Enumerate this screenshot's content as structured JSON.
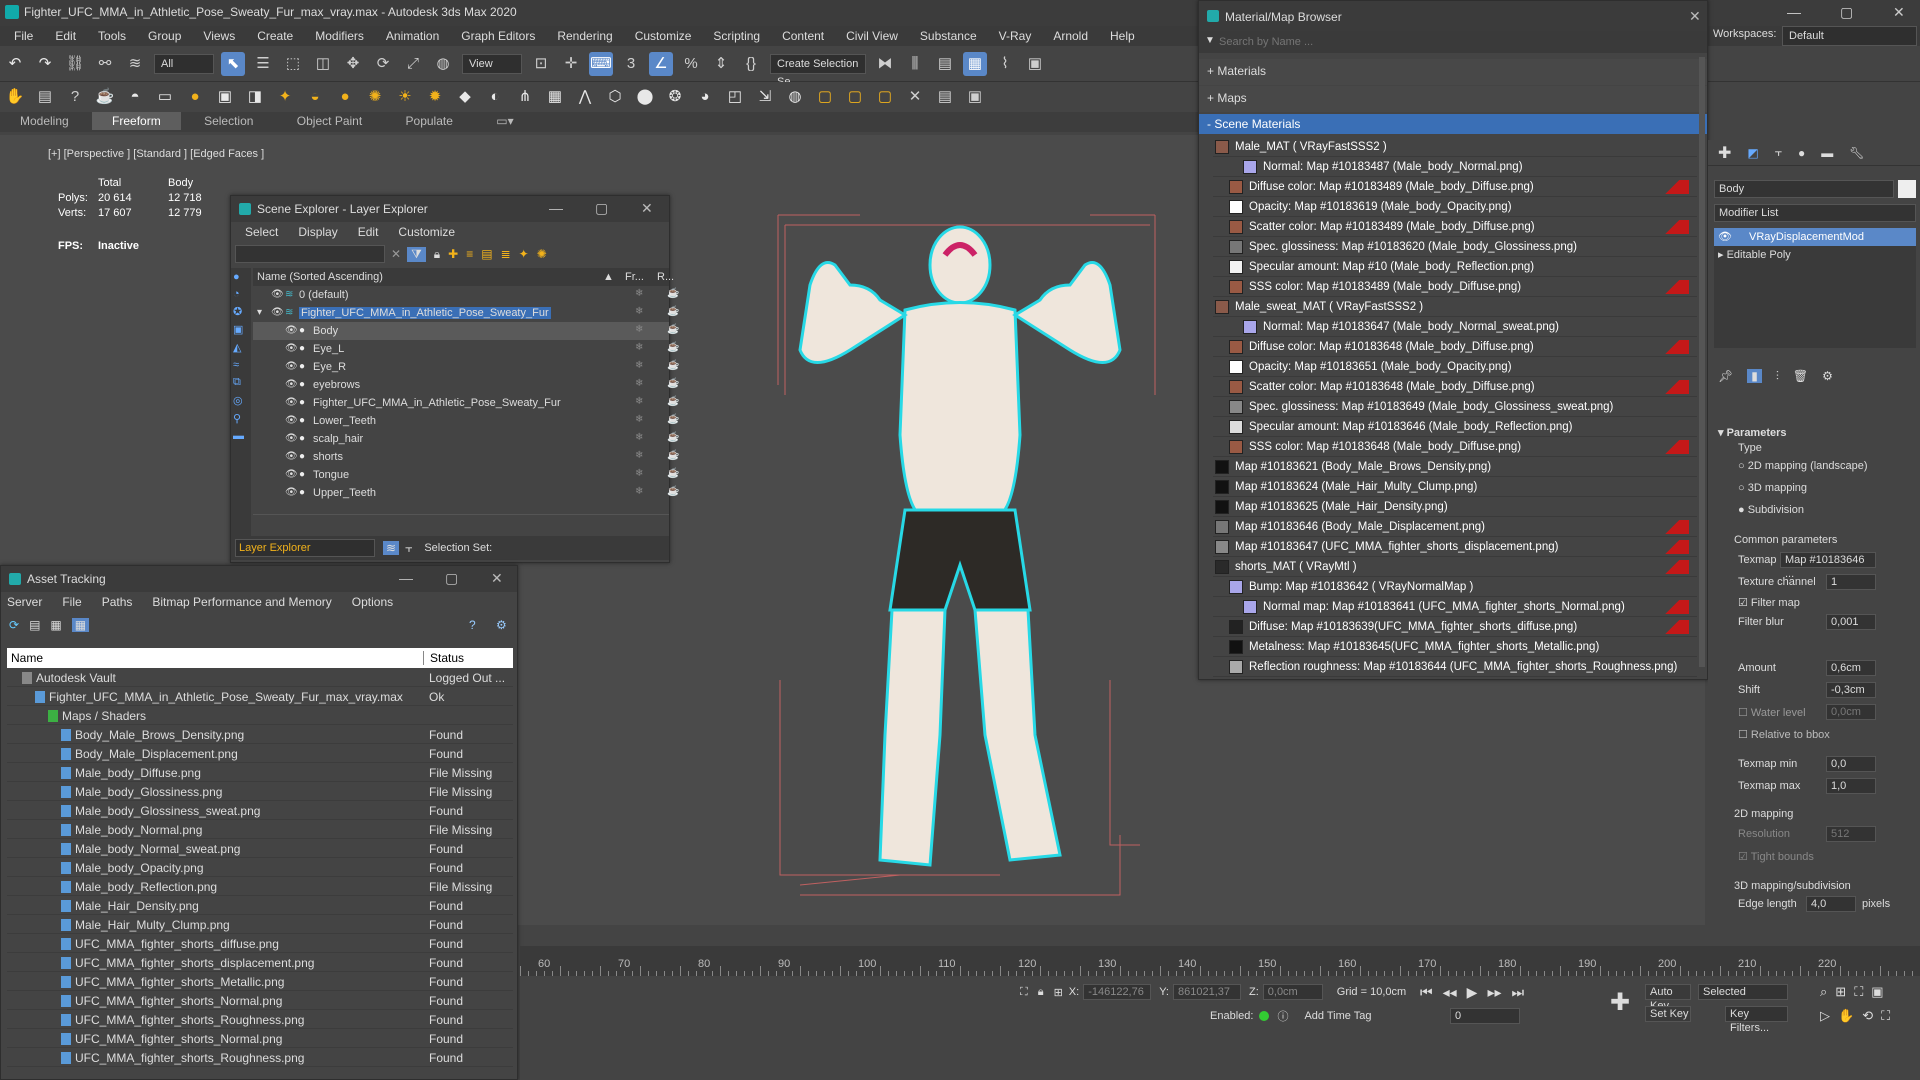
{
  "window": {
    "title": "Fighter_UFC_MMA_in_Athletic_Pose_Sweaty_Fur_max_vray.max - Autodesk 3ds Max 2020",
    "workspaces_label": "Workspaces:",
    "workspace": "Default"
  },
  "menu": [
    "File",
    "Edit",
    "Tools",
    "Group",
    "Views",
    "Create",
    "Modifiers",
    "Animation",
    "Graph Editors",
    "Rendering",
    "Customize",
    "Scripting",
    "Content",
    "Civil View",
    "Substance",
    "V-Ray",
    "Arnold",
    "Help"
  ],
  "toolbar": {
    "selection_filter": "All",
    "ref_coord": "View",
    "create_selection_set": "Create Selection Se"
  },
  "ribbon_tabs": [
    "Modeling",
    "Freeform",
    "Selection",
    "Object Paint",
    "Populate"
  ],
  "viewport": {
    "label": "[+] [Perspective ] [Standard ] [Edged Faces ]",
    "stats": {
      "col_total": "Total",
      "col_body": "Body",
      "polys_label": "Polys:",
      "polys_total": "20 614",
      "polys_body": "12 718",
      "verts_label": "Verts:",
      "verts_total": "17 607",
      "verts_body": "12 779",
      "fps_label": "FPS:",
      "fps_value": "Inactive"
    }
  },
  "scene_explorer": {
    "title": "Scene Explorer - Layer Explorer",
    "menu": [
      "Select",
      "Display",
      "Edit",
      "Customize"
    ],
    "col_name": "Name (Sorted Ascending)",
    "col_fr": "Fr...",
    "col_r": "R...",
    "rows": [
      {
        "name": "0 (default)",
        "indent": 0
      },
      {
        "name": "Fighter_UFC_MMA_in_Athletic_Pose_Sweaty_Fur",
        "indent": 0
      },
      {
        "name": "Body",
        "indent": 1
      },
      {
        "name": "Eye_L",
        "indent": 1
      },
      {
        "name": "Eye_R",
        "indent": 1
      },
      {
        "name": "eyebrows",
        "indent": 1
      },
      {
        "name": "Fighter_UFC_MMA_in_Athletic_Pose_Sweaty_Fur",
        "indent": 1
      },
      {
        "name": "Lower_Teeth",
        "indent": 1
      },
      {
        "name": "scalp_hair",
        "indent": 1
      },
      {
        "name": "shorts",
        "indent": 1
      },
      {
        "name": "Tongue",
        "indent": 1
      },
      {
        "name": "Upper_Teeth",
        "indent": 1
      }
    ],
    "footer_mode": "Layer Explorer",
    "selection_set_label": "Selection Set:"
  },
  "asset_tracking": {
    "title": "Asset Tracking",
    "menu": [
      "Server",
      "File",
      "Paths",
      "Bitmap Performance and Memory",
      "Options"
    ],
    "col_name": "Name",
    "col_status": "Status",
    "rows": [
      {
        "name": "Autodesk Vault",
        "status": "Logged Out ...",
        "indent": 1
      },
      {
        "name": "Fighter_UFC_MMA_in_Athletic_Pose_Sweaty_Fur_max_vray.max",
        "status": "Ok",
        "indent": 2
      },
      {
        "name": "Maps / Shaders",
        "status": "",
        "indent": 3
      },
      {
        "name": "Body_Male_Brows_Density.png",
        "status": "Found",
        "indent": 4
      },
      {
        "name": "Body_Male_Displacement.png",
        "status": "Found",
        "indent": 4
      },
      {
        "name": "Male_body_Diffuse.png",
        "status": "File Missing",
        "indent": 4
      },
      {
        "name": "Male_body_Glossiness.png",
        "status": "File Missing",
        "indent": 4
      },
      {
        "name": "Male_body_Glossiness_sweat.png",
        "status": "Found",
        "indent": 4
      },
      {
        "name": "Male_body_Normal.png",
        "status": "File Missing",
        "indent": 4
      },
      {
        "name": "Male_body_Normal_sweat.png",
        "status": "Found",
        "indent": 4
      },
      {
        "name": "Male_body_Opacity.png",
        "status": "Found",
        "indent": 4
      },
      {
        "name": "Male_body_Reflection.png",
        "status": "File Missing",
        "indent": 4
      },
      {
        "name": "Male_Hair_Density.png",
        "status": "Found",
        "indent": 4
      },
      {
        "name": "Male_Hair_Multy_Clump.png",
        "status": "Found",
        "indent": 4
      },
      {
        "name": "UFC_MMA_fighter_shorts_diffuse.png",
        "status": "Found",
        "indent": 4
      },
      {
        "name": "UFC_MMA_fighter_shorts_displacement.png",
        "status": "Found",
        "indent": 4
      },
      {
        "name": "UFC_MMA_fighter_shorts_Metallic.png",
        "status": "Found",
        "indent": 4
      },
      {
        "name": "UFC_MMA_fighter_shorts_Normal.png",
        "status": "Found",
        "indent": 4
      },
      {
        "name": "UFC_MMA_fighter_shorts_Roughness.png",
        "status": "Found",
        "indent": 4
      },
      {
        "name": "UFC_MMA_fighter_shorts_Normal.png",
        "status": "Found",
        "indent": 4
      },
      {
        "name": "UFC_MMA_fighter_shorts_Roughness.png",
        "status": "Found",
        "indent": 4
      }
    ]
  },
  "material_browser": {
    "title": "Material/Map Browser",
    "search_placeholder": "Search by Name ...",
    "sections": [
      "+ Materials",
      "+ Maps",
      "- Scene Materials"
    ],
    "rows": [
      {
        "text": "Male_MAT  ( VRayFastSSS2 )",
        "indent": 0,
        "swatch": "#8a5a4a",
        "red": false
      },
      {
        "text": "Normal: Map #10183487 (Male_body_Normal.png)",
        "indent": 2,
        "swatch": "#a9a6ea",
        "red": false
      },
      {
        "text": "Diffuse color: Map #10183489 (Male_body_Diffuse.png)",
        "indent": 1,
        "swatch": "#9a5a44",
        "red": true
      },
      {
        "text": "Opacity: Map #10183619 (Male_body_Opacity.png)",
        "indent": 1,
        "swatch": "#ffffff",
        "red": false
      },
      {
        "text": "Scatter color: Map #10183489 (Male_body_Diffuse.png)",
        "indent": 1,
        "swatch": "#9a5a44",
        "red": true
      },
      {
        "text": "Spec. glossiness: Map #10183620 (Male_body_Glossiness.png)",
        "indent": 1,
        "swatch": "#777777",
        "red": false
      },
      {
        "text": "Specular amount: Map #10 (Male_body_Reflection.png)",
        "indent": 1,
        "swatch": "#f2f2f2",
        "red": false
      },
      {
        "text": "SSS color: Map #10183489 (Male_body_Diffuse.png)",
        "indent": 1,
        "swatch": "#9a5a44",
        "red": true
      },
      {
        "text": "Male_sweat_MAT  ( VRayFastSSS2 )",
        "indent": 0,
        "swatch": "#8a5a4a",
        "red": false
      },
      {
        "text": "Normal: Map #10183647 (Male_body_Normal_sweat.png)",
        "indent": 2,
        "swatch": "#a9a6ea",
        "red": false
      },
      {
        "text": "Diffuse color: Map #10183648 (Male_body_Diffuse.png)",
        "indent": 1,
        "swatch": "#9a5a44",
        "red": true
      },
      {
        "text": "Opacity: Map #10183651 (Male_body_Opacity.png)",
        "indent": 1,
        "swatch": "#ffffff",
        "red": false
      },
      {
        "text": "Scatter color: Map #10183648 (Male_body_Diffuse.png)",
        "indent": 1,
        "swatch": "#9a5a44",
        "red": true
      },
      {
        "text": "Spec. glossiness: Map #10183649 (Male_body_Glossiness_sweat.png)",
        "indent": 1,
        "swatch": "#888888",
        "red": false
      },
      {
        "text": "Specular amount: Map #10183646 (Male_body_Reflection.png)",
        "indent": 1,
        "swatch": "#dddddd",
        "red": false
      },
      {
        "text": "SSS color: Map #10183648 (Male_body_Diffuse.png)",
        "indent": 1,
        "swatch": "#9a5a44",
        "red": true
      },
      {
        "text": "Map #10183621 (Body_Male_Brows_Density.png)",
        "indent": 0,
        "swatch": "#111111",
        "red": false
      },
      {
        "text": "Map #10183624 (Male_Hair_Multy_Clump.png)",
        "indent": 0,
        "swatch": "#111111",
        "red": false
      },
      {
        "text": "Map #10183625 (Male_Hair_Density.png)",
        "indent": 0,
        "swatch": "#111111",
        "red": false
      },
      {
        "text": "Map #10183646 (Body_Male_Displacement.png)",
        "indent": 0,
        "swatch": "#777777",
        "red": true
      },
      {
        "text": "Map #10183647 (UFC_MMA_fighter_shorts_displacement.png)",
        "indent": 0,
        "swatch": "#888888",
        "red": true
      },
      {
        "text": "shorts_MAT  ( VRayMtl )",
        "indent": 0,
        "swatch": "#2a2a2a",
        "red": true
      },
      {
        "text": "Bump: Map #10183642  ( VRayNormalMap )",
        "indent": 1,
        "swatch": "#a9a6ea",
        "red": false
      },
      {
        "text": "Normal map: Map #10183641 (UFC_MMA_fighter_shorts_Normal.png)",
        "indent": 2,
        "swatch": "#a9a6ea",
        "red": true
      },
      {
        "text": "Diffuse: Map #10183639(UFC_MMA_fighter_shorts_diffuse.png)",
        "indent": 1,
        "swatch": "#222222",
        "red": true
      },
      {
        "text": "Metalness: Map #10183645(UFC_MMA_fighter_shorts_Metallic.png)",
        "indent": 1,
        "swatch": "#111111",
        "red": false
      },
      {
        "text": "Reflection roughness: Map #10183644 (UFC_MMA_fighter_shorts_Roughness.png)",
        "indent": 1,
        "swatch": "#aaaaaa",
        "red": false
      }
    ]
  },
  "command_panel": {
    "object_name": "Body",
    "modifier_list": "Modifier List",
    "stack": [
      "VRayDisplacementMod",
      "Editable Poly"
    ],
    "rollout": "Parameters",
    "type_label": "Type",
    "types": [
      "2D mapping (landscape)",
      "3D mapping",
      "Subdivision"
    ],
    "common_label": "Common parameters",
    "texmap_label": "Texmap",
    "texmap_value": "Map #10183646 ...",
    "tex_channel_label": "Texture channel",
    "tex_channel": "1",
    "filter_map": "Filter map",
    "filter_blur_label": "Filter blur",
    "filter_blur": "0,001",
    "amount_label": "Amount",
    "amount": "0,6cm",
    "shift_label": "Shift",
    "shift": "-0,3cm",
    "water_level_label": "Water level",
    "water_level": "0,0cm",
    "relative_bbox": "Relative to bbox",
    "texmap_min_label": "Texmap min",
    "texmap_min": "0,0",
    "texmap_max_label": "Texmap max",
    "texmap_max": "1,0",
    "mapping2d_label": "2D mapping",
    "resolution_label": "Resolution",
    "resolution": "512",
    "tight_bounds": "Tight bounds",
    "mapping3d_label": "3D mapping/subdivision",
    "edge_length_label": "Edge length",
    "edge_length": "4,0",
    "pixels_label": "pixels"
  },
  "timeline": {
    "ticks": [
      "60",
      "70",
      "80",
      "90",
      "100",
      "110",
      "120",
      "130",
      "140",
      "150",
      "160",
      "170",
      "180",
      "190",
      "200",
      "210",
      "220"
    ]
  },
  "status": {
    "x_label": "X:",
    "x_value": "-146122,76",
    "y_label": "Y:",
    "y_value": "861021,37",
    "z_label": "Z:",
    "z_value": "0,0cm",
    "grid": "Grid = 10,0cm",
    "enabled_label": "Enabled:",
    "add_time_tag": "Add Time Tag",
    "auto_key": "Auto Key",
    "set_key": "Set Key",
    "selected": "Selected",
    "key_filters": "Key Filters...",
    "frame": "0"
  }
}
